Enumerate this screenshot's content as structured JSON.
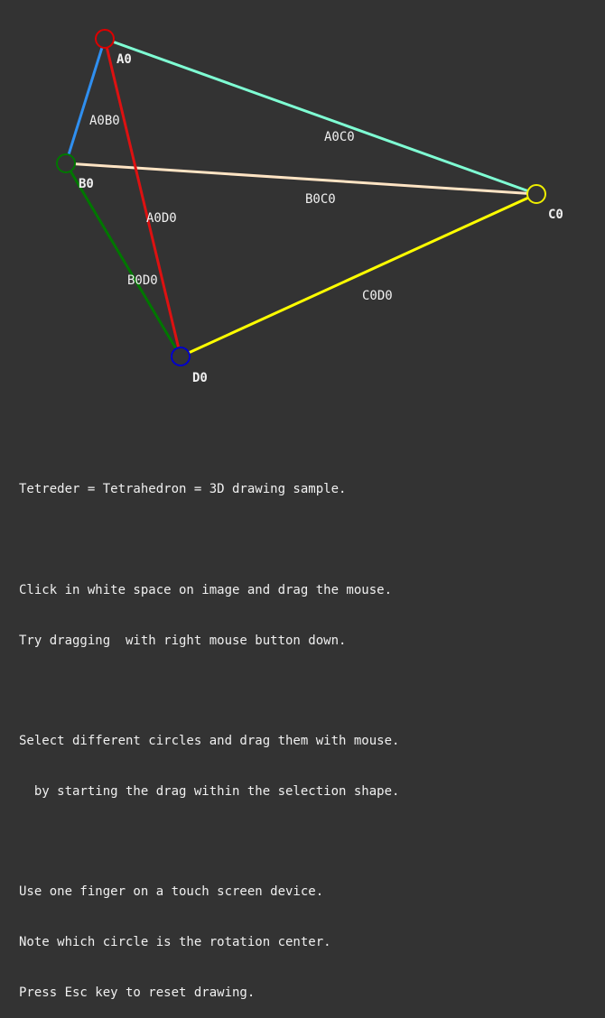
{
  "vertices": [
    {
      "id": "A0",
      "label": "A0",
      "color": "#dd0000"
    },
    {
      "id": "B0",
      "label": "B0",
      "color": "#007700"
    },
    {
      "id": "C0",
      "label": "C0",
      "color": "#eeee00"
    },
    {
      "id": "D0",
      "label": "D0",
      "color": "#0000cc"
    }
  ],
  "edges": [
    {
      "id": "A0B0",
      "label": "A0B0",
      "color": "#2f8ff0"
    },
    {
      "id": "A0C0",
      "label": "A0C0",
      "color": "#7fffd4"
    },
    {
      "id": "A0D0",
      "label": "A0D0",
      "color": "#dd1111"
    },
    {
      "id": "B0C0",
      "label": "B0C0",
      "color": "#ffe4c4"
    },
    {
      "id": "B0D0",
      "label": "B0D0",
      "color": "#007700"
    },
    {
      "id": "C0D0",
      "label": "C0D0",
      "color": "#ffff00"
    }
  ],
  "instructions": [
    "Tetreder = Tetrahedron = 3D drawing sample.",
    "",
    "Click in white space on image and drag the mouse.",
    "Try dragging  with right mouse button down.",
    "",
    "Select different circles and drag them with mouse.",
    "  by starting the drag within the selection shape.",
    "",
    "Use one finger on a touch screen device.",
    "Note which circle is the rotation center.",
    "Press Esc key to reset drawing."
  ]
}
